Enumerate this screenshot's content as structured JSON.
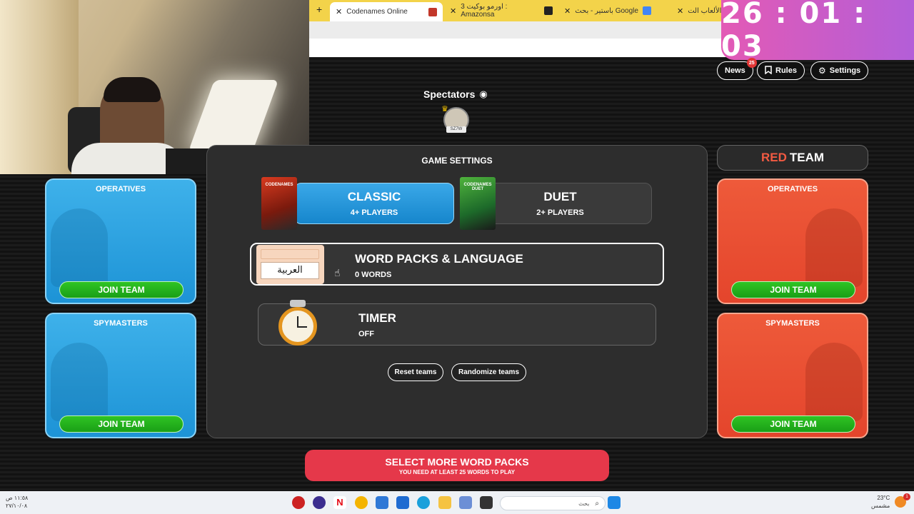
{
  "browser": {
    "tabs": [
      {
        "label": "Codenames Online",
        "active": true
      },
      {
        "label": "اورمو بوكيت 3 : Amazonsa",
        "active": false
      },
      {
        "label": "باستير - بحث Google",
        "active": false
      },
      {
        "label": "قائمة الألعاب الت",
        "active": false
      }
    ],
    "new_tab": "+"
  },
  "timer_overlay": {
    "value": "26 : 01 : 03"
  },
  "topnav": {
    "news": {
      "label": "News",
      "badge": "25"
    },
    "rules": {
      "label": "Rules"
    },
    "settings": {
      "label": "Settings"
    }
  },
  "spectators": {
    "label": "Spectators",
    "user": "SZ7W"
  },
  "blue_team": {
    "operatives": {
      "title": "OPERATIVES",
      "join": "JOIN TEAM"
    },
    "spymasters": {
      "title": "SPYMASTERS",
      "join": "JOIN TEAM"
    }
  },
  "red_team": {
    "header_red": "RED",
    "header_team": "TEAM",
    "operatives": {
      "title": "OPERATIVES",
      "join": "JOIN TEAM"
    },
    "spymasters": {
      "title": "SPYMASTERS",
      "join": "JOIN TEAM"
    }
  },
  "game_settings": {
    "title": "GAME SETTINGS",
    "modes": {
      "classic": {
        "name": "CLASSIC",
        "players": "4+ PLAYERS",
        "box_label": "CODENAMES",
        "selected": true
      },
      "duet": {
        "name": "DUET",
        "players": "2+ PLAYERS",
        "box_label": "CODENAMES DUET",
        "selected": false
      }
    },
    "word_packs": {
      "title": "WORD PACKS & LANGUAGE",
      "count": "0 WORDS",
      "language": "العربية"
    },
    "timer": {
      "title": "TIMER",
      "state": "OFF"
    },
    "reset_label": "Reset teams",
    "randomize_label": "Randomize teams"
  },
  "cta": {
    "title": "SELECT MORE WORD PACKS",
    "subtitle": "YOU NEED AT LEAST 25 WORDS TO PLAY"
  },
  "taskbar": {
    "search_placeholder": "بحث",
    "time": "١١:٥٨ ص",
    "date": "٢٧/١٠/٠٨",
    "weather_temp": "23°C",
    "weather_desc": "مشمس",
    "notification_count": "1"
  },
  "colors": {
    "blue_team": "#1d93d6",
    "red_team": "#e4452c",
    "join_green": "#1a9f16",
    "cta_red": "#e5384a",
    "timer_pink": "#e35ab5"
  }
}
